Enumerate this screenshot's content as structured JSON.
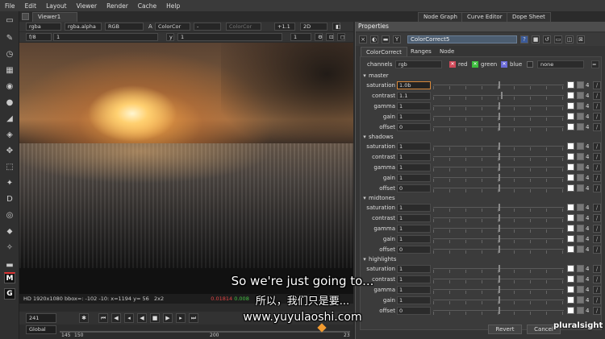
{
  "menu": [
    "File",
    "Edit",
    "Layout",
    "Viewer",
    "Render",
    "Cache",
    "Help"
  ],
  "viewer": {
    "tab": "Viewer1",
    "channels": "rgba",
    "alpha": "rgba.alpha",
    "display": "RGB",
    "a_label": "A",
    "a_input": "ColorCor",
    "b_input": "-",
    "b_disabled": "ColorCor",
    "gain": "+1.1",
    "view_mode": "2D",
    "fstop": "f/8",
    "frame_field": "1",
    "gamma_field": "1",
    "zoom_field": "1",
    "info": {
      "format": "HD 1920x1080 bbox=: -102 -10: x=1194 y= 56",
      "proxy": "2x2",
      "red": "0.01814",
      "green": "0.008"
    },
    "timeline": {
      "frame": "241",
      "range_mode": "Global",
      "ticks": [
        "145",
        "150",
        "200",
        "23"
      ]
    }
  },
  "tabs_right": [
    "Node Graph",
    "Curve Editor",
    "Dope Sheet"
  ],
  "properties": {
    "title": "Properties",
    "node_name": "ColorCorrect5",
    "tabs": [
      "ColorCorrect",
      "Ranges",
      "Node"
    ],
    "channels_label": "channels",
    "channels_value": "rgb",
    "checks": [
      {
        "label": "red",
        "color": "#d04a5a"
      },
      {
        "label": "green",
        "color": "#3dbd3d"
      },
      {
        "label": "blue",
        "color": "#6a6ad8"
      }
    ],
    "mask_value": "none",
    "swatch_num": "4",
    "sections": [
      {
        "name": "master",
        "rows": [
          {
            "name": "saturation",
            "value": "1.0b",
            "knob": 0.5,
            "focus": true
          },
          {
            "name": "contrast",
            "value": "1.1",
            "knob": 0.52
          },
          {
            "name": "gamma",
            "value": "1",
            "knob": 0.5
          },
          {
            "name": "gain",
            "value": "1",
            "knob": 0.5
          },
          {
            "name": "offset",
            "value": "0",
            "knob": 0.5
          }
        ]
      },
      {
        "name": "shadows",
        "rows": [
          {
            "name": "saturation",
            "value": "1",
            "knob": 0.5
          },
          {
            "name": "contrast",
            "value": "1",
            "knob": 0.5
          },
          {
            "name": "gamma",
            "value": "1",
            "knob": 0.5
          },
          {
            "name": "gain",
            "value": "1",
            "knob": 0.5
          },
          {
            "name": "offset",
            "value": "0",
            "knob": 0.5
          }
        ]
      },
      {
        "name": "midtones",
        "rows": [
          {
            "name": "saturation",
            "value": "1",
            "knob": 0.5
          },
          {
            "name": "contrast",
            "value": "1",
            "knob": 0.5
          },
          {
            "name": "gamma",
            "value": "1",
            "knob": 0.5
          },
          {
            "name": "gain",
            "value": "1",
            "knob": 0.5
          },
          {
            "name": "offset",
            "value": "0",
            "knob": 0.5
          }
        ]
      },
      {
        "name": "highlights",
        "rows": [
          {
            "name": "saturation",
            "value": "1",
            "knob": 0.5
          },
          {
            "name": "contrast",
            "value": "1",
            "knob": 0.5
          },
          {
            "name": "gamma",
            "value": "1",
            "knob": 0.5
          },
          {
            "name": "gain",
            "value": "1",
            "knob": 0.5
          },
          {
            "name": "offset",
            "value": "0",
            "knob": 0.5
          }
        ]
      }
    ],
    "revert_label": "Revert",
    "cancel_label": "Cancel"
  },
  "toolbar_brand": {
    "m": "M",
    "g": "G"
  },
  "subtitles": {
    "en": "So we're just going to...",
    "zh": "所以，我们只是要...",
    "url": "www.yuyulaoshi.com"
  },
  "watermark": "pluralsight"
}
